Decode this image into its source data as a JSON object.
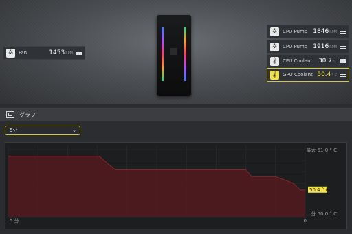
{
  "tiles": {
    "fan": {
      "label": "Fan",
      "value": "1453",
      "unit": "RPM",
      "icon": "fan-icon"
    },
    "cpu_pump_1": {
      "label": "CPU Pump",
      "value": "1846",
      "unit": "RPM",
      "icon": "fan-icon"
    },
    "cpu_pump_2": {
      "label": "CPU Pump",
      "value": "1916",
      "unit": "RPM",
      "icon": "fan-icon"
    },
    "cpu_coolant": {
      "label": "CPU Coolant",
      "value": "30.7",
      "unit": "°C",
      "icon": "thermometer-icon"
    },
    "gpu_coolant": {
      "label": "GPU Coolant",
      "value": "50.4",
      "unit": "° C",
      "icon": "thermometer-icon"
    }
  },
  "graph": {
    "title": "グラフ",
    "range_selected": "5分",
    "accent_color": "#d6c83b",
    "line_color": "#7a1f24"
  },
  "chart_data": {
    "type": "area",
    "x_left_label": "5 分",
    "x_right_label": "0",
    "max_label": "最大 51.0 ° C",
    "min_label": "分 50.0 ° C",
    "current_label": "50.4 ° C",
    "ylim": [
      50.0,
      51.0
    ],
    "x": [
      300,
      245,
      208,
      200,
      192,
      180,
      120,
      80,
      60,
      54,
      30,
      12,
      5,
      0
    ],
    "values": [
      50.9,
      50.9,
      50.9,
      50.8,
      50.7,
      50.7,
      50.7,
      50.7,
      50.7,
      50.6,
      50.6,
      50.5,
      50.4,
      50.4
    ],
    "grid": true
  }
}
